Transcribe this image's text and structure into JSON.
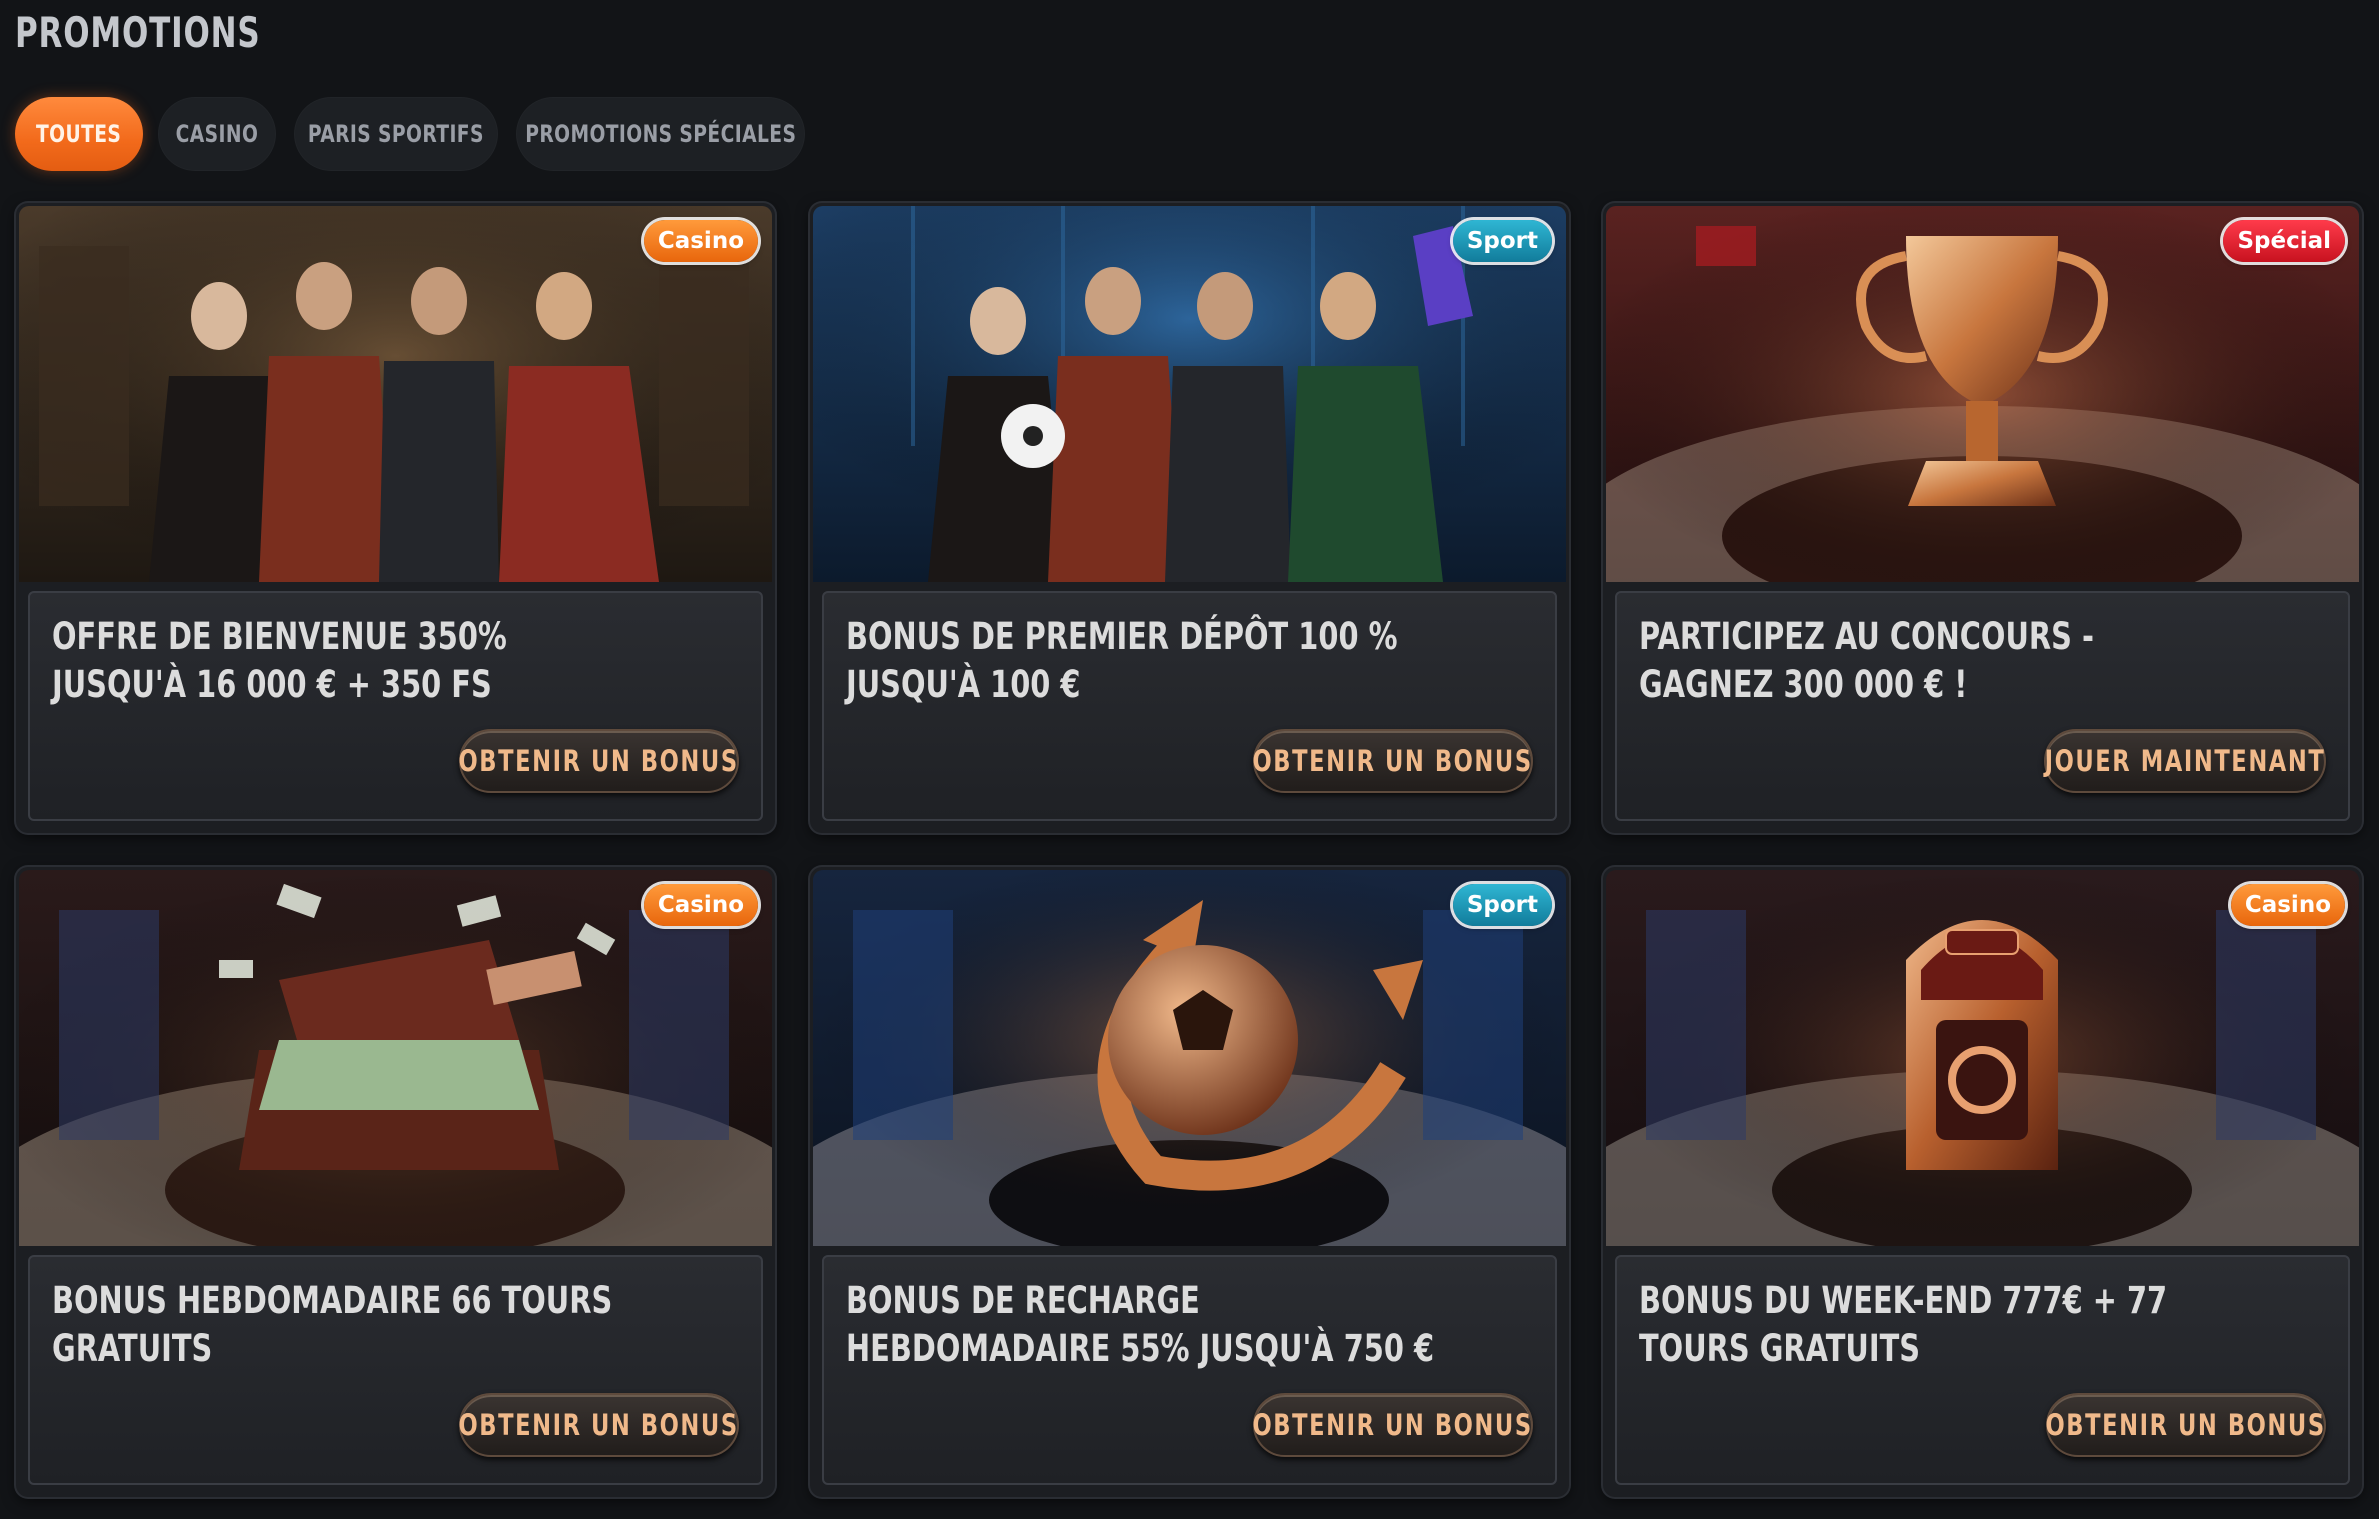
{
  "page": {
    "title": "PROMOTIONS"
  },
  "filters": [
    {
      "label": "TOUTES",
      "active": true
    },
    {
      "label": "CASINO",
      "active": false
    },
    {
      "label": "PARIS SPORTIFS",
      "active": false
    },
    {
      "label": "PROMOTIONS SPÉCIALES",
      "active": false
    }
  ],
  "colors": {
    "accent": "#f26a1b",
    "background": "#121417",
    "badge_casino": "#f07a1c",
    "badge_sport": "#1e9bba",
    "badge_special": "#e11d2c",
    "cta_text": "#f0b98a"
  },
  "cards": [
    {
      "badge": "Casino",
      "image": "casino-hosts-illustration",
      "headline": "OFFRE DE BIENVENUE 350% JUSQU'À 16 000 € + 350 FS",
      "cta": "OBTENIR UN BONUS"
    },
    {
      "badge": "Sport",
      "image": "sport-hosts-football-illustration",
      "headline": "BONUS DE PREMIER DÉPÔT 100 % JUSQU'À 100 €",
      "cta": "OBTENIR UN BONUS"
    },
    {
      "badge": "Spécial",
      "image": "gransino-trophy-illustration",
      "headline": "PARTICIPEZ AU CONCOURS - GAGNEZ 300 000 € !",
      "cta": "JOUER MAINTENANT"
    },
    {
      "badge": "Casino",
      "image": "money-suitcase-mon-thu-illustration",
      "headline": "BONUS HEBDOMADAIRE 66 TOURS GRATUITS",
      "cta": "OBTENIR UN BONUS"
    },
    {
      "badge": "Sport",
      "image": "football-arrow-illustration",
      "headline": "BONUS DE RECHARGE HEBDOMADAIRE 55% JUSQU'À 750 €",
      "cta": "OBTENIR UN BONUS"
    },
    {
      "badge": "Casino",
      "image": "fri-sun-slot-machine-illustration",
      "headline": "BONUS DU WEEK-END 777€ + 77 TOURS GRATUITS",
      "cta": "OBTENIR UN BONUS"
    }
  ]
}
